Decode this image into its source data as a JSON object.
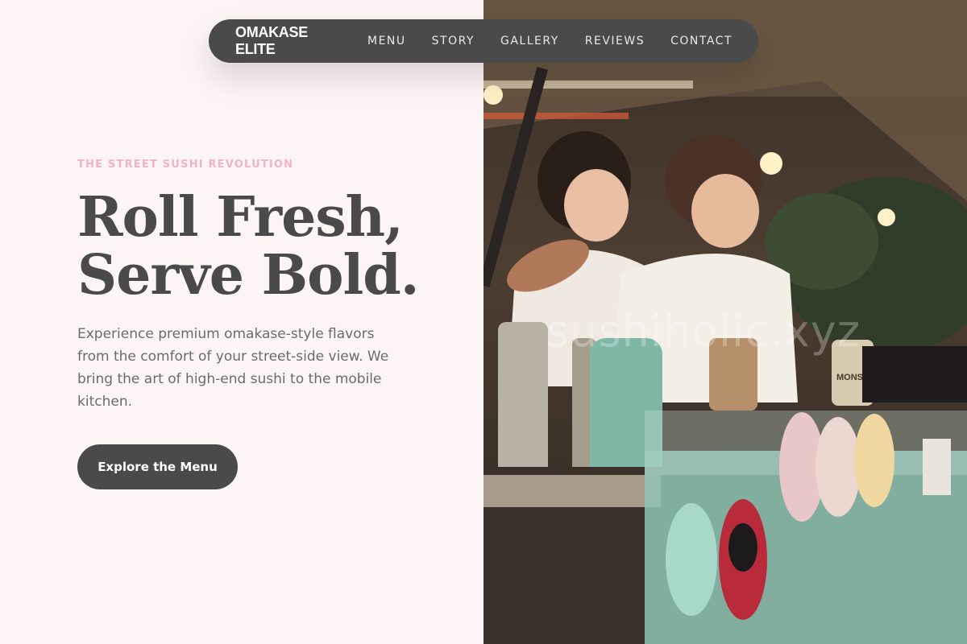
{
  "nav": {
    "brand": "OMAKASE ELITE",
    "links": [
      "MENU",
      "STORY",
      "GALLERY",
      "REVIEWS",
      "CONTACT"
    ]
  },
  "hero": {
    "eyebrow": "THE STREET SUSHI REVOLUTION",
    "headline_line1": "Roll Fresh,",
    "headline_line2": "Serve Bold.",
    "description": "Experience premium omakase-style flavors from the comfort of your street-side view. We bring the art of high-end sushi to the mobile kitchen.",
    "cta_label": "Explore the Menu"
  },
  "photo": {
    "watermark": "sushiholic.xyz",
    "sign_text": "MONS"
  },
  "colors": {
    "background": "#fdf4f5",
    "accent_pink": "#f0b3c6",
    "dark": "#4a4a4a",
    "body_text": "#6b6b6b"
  }
}
